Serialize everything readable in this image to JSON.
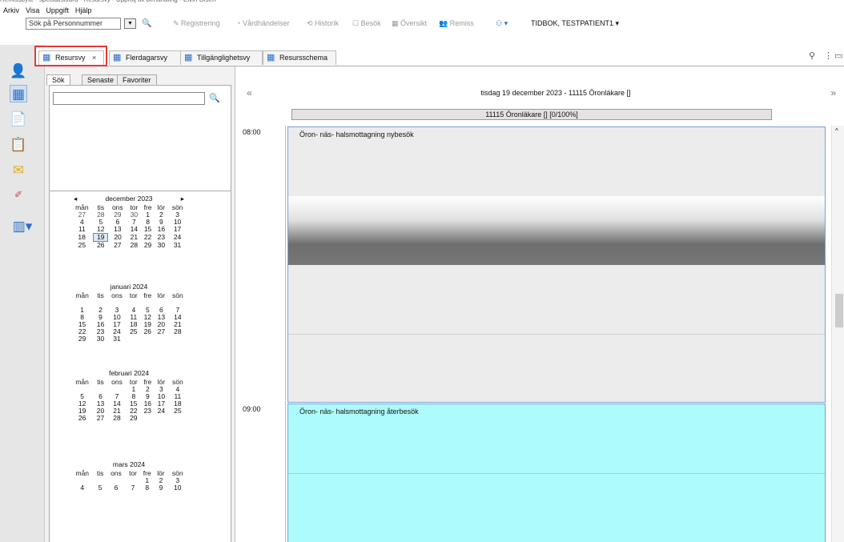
{
  "window": {
    "title": "Remissbyte - specialistvård - Resursvy - Uppfölj av behandling - Elvin Olsen"
  },
  "menu": [
    "Arkiv",
    "Visa",
    "Uppgift",
    "Hjälp"
  ],
  "toolbar": {
    "search_value": "Sök på Personnummer",
    "items": [
      "Registrering",
      "Vårdhändelser",
      "Historik",
      "Besök",
      "Översikt",
      "Remiss"
    ],
    "patient": "TIDBOK, TESTPATIENT1"
  },
  "tabs": [
    {
      "label": "Resursvy",
      "close": "×"
    },
    {
      "label": "Flerdagarsvy"
    },
    {
      "label": "Tillgänglighetsvy"
    },
    {
      "label": "Resursschema"
    }
  ],
  "left_panel": {
    "tabs": [
      "Sök",
      "Senaste",
      "Favoriter"
    ],
    "calendars": [
      {
        "month": "december 2023",
        "weekdays": [
          "mån",
          "tis",
          "ons",
          "tor",
          "fre",
          "lör",
          "sön"
        ],
        "rows": [
          [
            "27",
            "28",
            "29",
            "30",
            "1",
            "2",
            "3"
          ],
          [
            "4",
            "5",
            "6",
            "7",
            "8",
            "9",
            "10"
          ],
          [
            "11",
            "12",
            "13",
            "14",
            "15",
            "16",
            "17"
          ],
          [
            "18",
            "19",
            "20",
            "21",
            "22",
            "23",
            "24"
          ],
          [
            "25",
            "26",
            "27",
            "28",
            "29",
            "30",
            "31"
          ]
        ],
        "selected": "19"
      },
      {
        "month": "januari 2024",
        "weekdays": [
          "mån",
          "tis",
          "ons",
          "tor",
          "fre",
          "lör",
          "sön"
        ],
        "rows": [
          [
            "",
            "",
            "",
            "",
            "",
            "",
            ""
          ],
          [
            "1",
            "2",
            "3",
            "4",
            "5",
            "6",
            "7"
          ],
          [
            "8",
            "9",
            "10",
            "11",
            "12",
            "13",
            "14"
          ],
          [
            "15",
            "16",
            "17",
            "18",
            "19",
            "20",
            "21"
          ],
          [
            "22",
            "23",
            "24",
            "25",
            "26",
            "27",
            "28"
          ],
          [
            "29",
            "30",
            "31",
            "",
            "",
            "",
            ""
          ]
        ]
      },
      {
        "month": "februari 2024",
        "weekdays": [
          "mån",
          "tis",
          "ons",
          "tor",
          "fre",
          "lör",
          "sön"
        ],
        "rows": [
          [
            "",
            "",
            "",
            "1",
            "2",
            "3",
            "4"
          ],
          [
            "5",
            "6",
            "7",
            "8",
            "9",
            "10",
            "11"
          ],
          [
            "12",
            "13",
            "14",
            "15",
            "16",
            "17",
            "18"
          ],
          [
            "19",
            "20",
            "21",
            "22",
            "23",
            "24",
            "25"
          ],
          [
            "26",
            "27",
            "28",
            "29",
            "",
            "",
            ""
          ]
        ]
      },
      {
        "month": "mars 2024",
        "weekdays": [
          "mån",
          "tis",
          "ons",
          "tor",
          "fre",
          "lör",
          "sön"
        ],
        "rows": [
          [
            "",
            "",
            "",
            "",
            "1",
            "2",
            "3"
          ],
          [
            "4",
            "5",
            "6",
            "7",
            "8",
            "9",
            "10"
          ]
        ]
      }
    ]
  },
  "schedule": {
    "nav_prev": "«",
    "nav_next": "»",
    "date_header": "tisdag 19 december 2023 - 11115 Öronläkare []",
    "column_header": "11115 Öronläkare [] [0/100%]",
    "times": [
      "08:00",
      "09:00"
    ],
    "blocks": [
      {
        "label": "Öron- näs- halsmottagning nybesök",
        "color": "#ececec"
      },
      {
        "label": "Öron- näs- halsmottagning återbesök",
        "color": "#aefbfd"
      }
    ]
  }
}
